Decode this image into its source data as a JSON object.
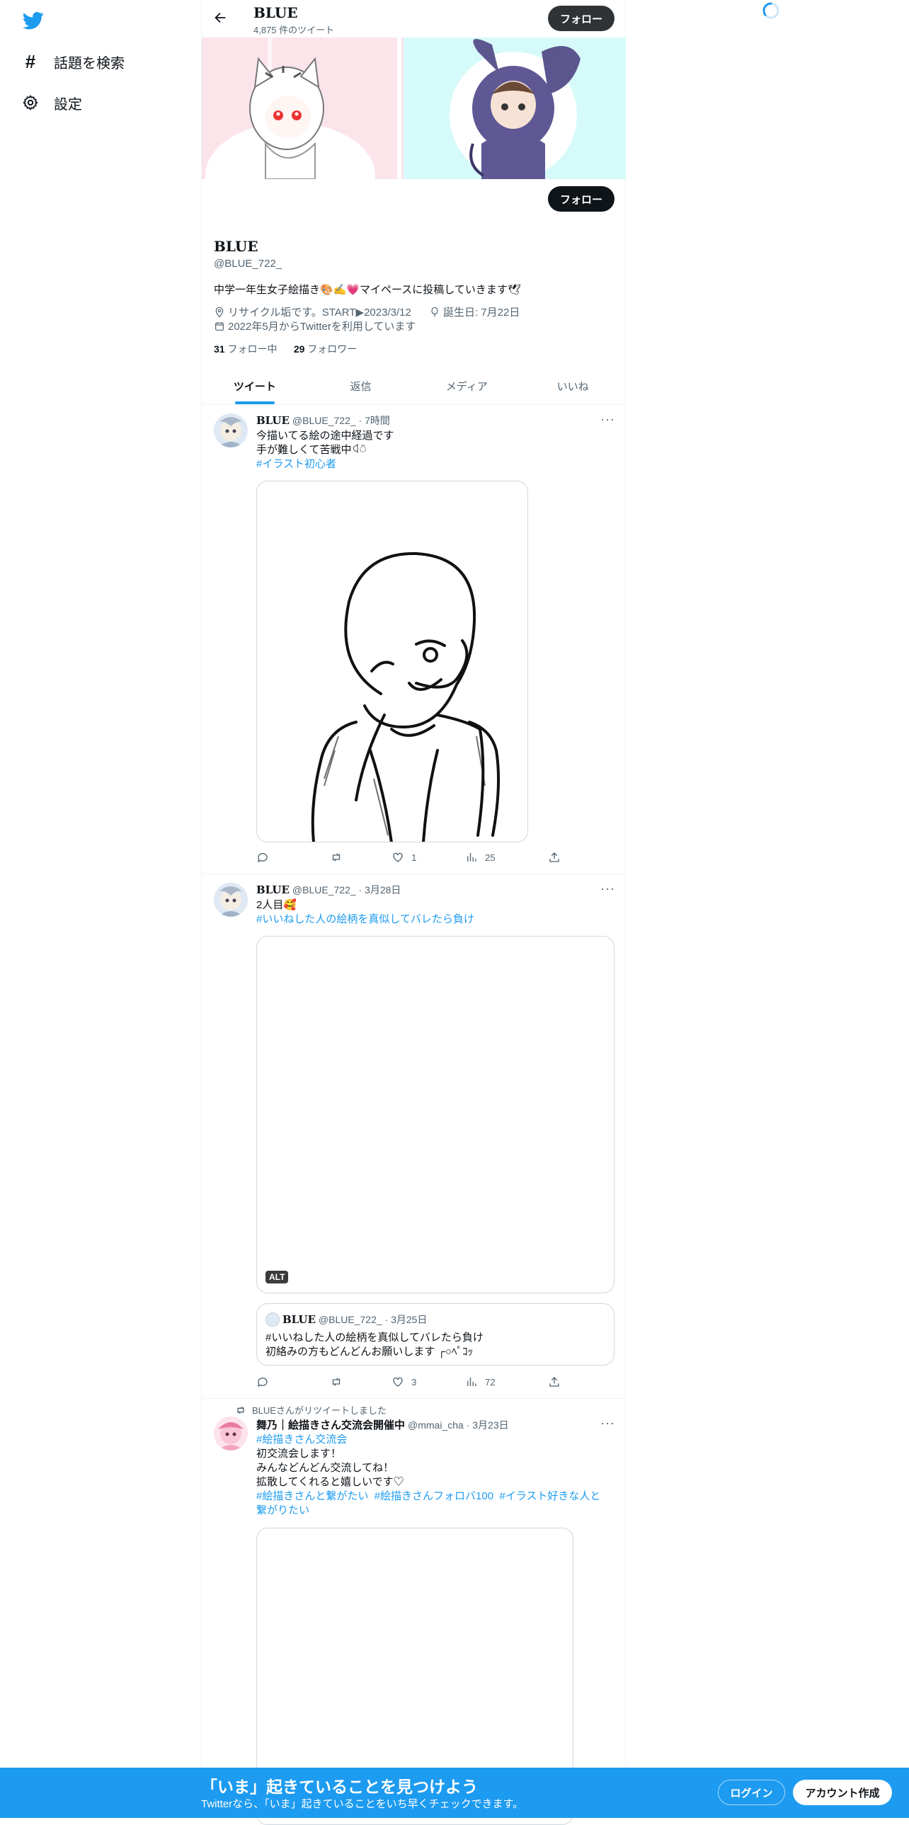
{
  "nav": {
    "items": [
      {
        "label": "話題を検索",
        "icon": "hashtag-icon"
      },
      {
        "label": "設定",
        "icon": "gear-icon"
      }
    ]
  },
  "header": {
    "title": "BLUE",
    "tweet_count": "4,875 件のツイート",
    "follow_label": "フォロー"
  },
  "profile": {
    "name": "BLUE",
    "handle": "@BLUE_722_",
    "follow_label": "フォロー",
    "bio": "中学一年生女子絵描き🎨✍️💗マイペースに投稿していきます🕊",
    "location": "リサイクル垢です。START▶2023/3/12",
    "birthday": "誕生日: 7月22日",
    "joined": "2022年5月からTwitterを利用しています",
    "following_count": "31",
    "following_label": "フォロー中",
    "followers_count": "29",
    "followers_label": "フォロワー"
  },
  "tabs": [
    "ツイート",
    "返信",
    "メディア",
    "いいね"
  ],
  "tweets": [
    {
      "name": "BLUE",
      "handle_time": "@BLUE_722_ · 7時間",
      "lines": [
        "今描いてる絵の途中経過です",
        "手が難しくて苦戦中ꒉ⍥"
      ],
      "hashtag": "#イラスト初心者",
      "replies": "",
      "retweets": "",
      "likes": "1",
      "views": "25"
    },
    {
      "name": "BLUE",
      "handle_time": "@BLUE_722_ · 3月28日",
      "lines": [
        "2人目🥰"
      ],
      "hashtag": "#いいねした人の絵柄を真似してバレたら負け",
      "alt": "ALT",
      "quote": {
        "name": "BLUE",
        "handle_time": "@BLUE_722_ · 3月25日",
        "line1": "#いいねした人の絵柄を真似してバレたら負け",
        "line2": "初絡みの方もどんどんお願いします ┌○ﾍﾟｺｯ"
      },
      "likes": "3",
      "views": "72"
    },
    {
      "retweet_note": "BLUEさんがリツイートしました",
      "name": "舞乃｜絵描きさん交流会開催中",
      "handle_time": "@mmai_cha · 3月23日",
      "hashtag_top": "#絵描きさん交流会",
      "lines": [
        "初交流会します！",
        "みんなどんどん交流してね！",
        "拡散してくれると嬉しいです♡"
      ],
      "tags_line1": "#絵描きさんと繋がたい  #絵描きさんフォロバ100  #イラスト好きな人と",
      "tags_line2": "繋がりたい"
    }
  ],
  "bottom_bar": {
    "title": "「いま」起きていることを見つけよう",
    "subtitle": "Twitterなら、「いま」起きていることをいち早くチェックできます。",
    "login": "ログイン",
    "signup": "アカウント作成"
  },
  "colors": {
    "accent": "#1d9bf0",
    "text": "#0f1419",
    "muted": "#536471"
  }
}
